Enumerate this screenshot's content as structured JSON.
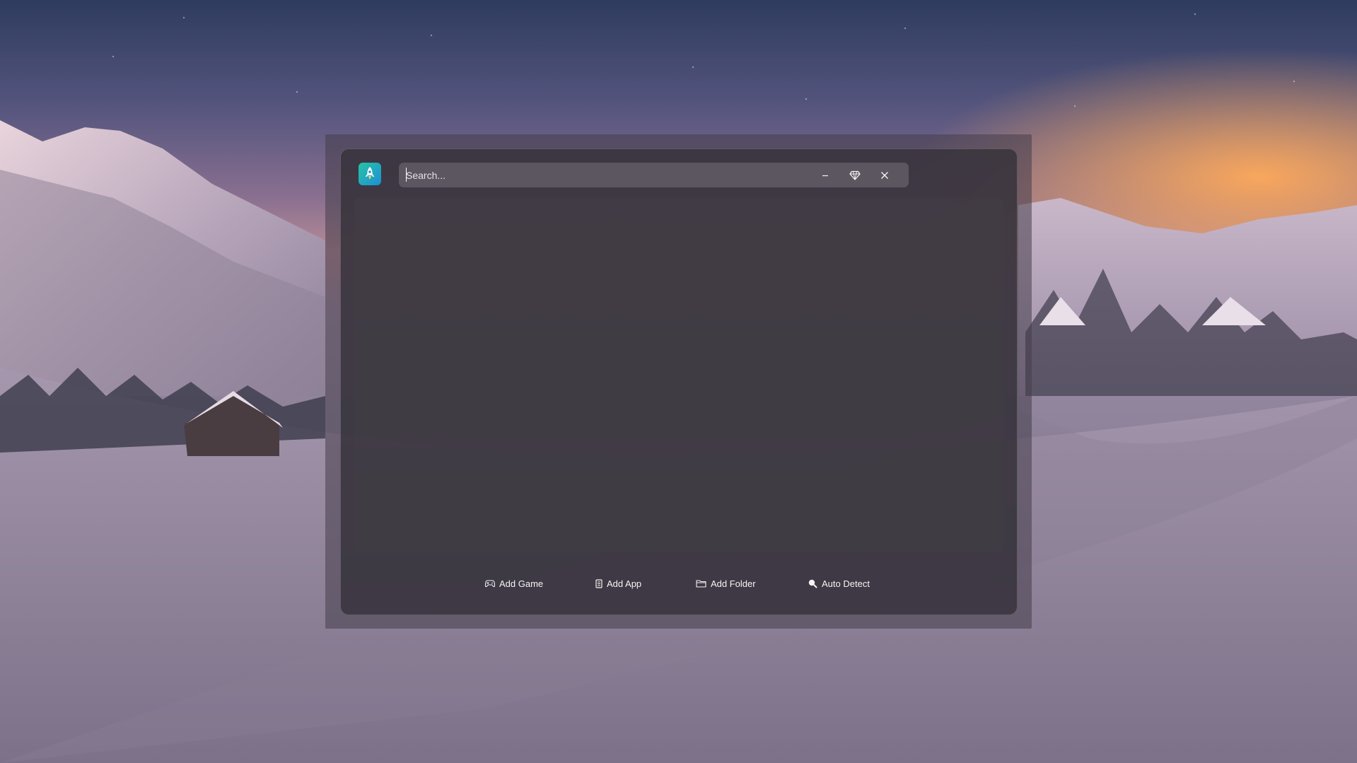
{
  "app": {
    "logo_icon": "rocket-icon",
    "accent_colors": [
      "#27c3a3",
      "#1d8fd6"
    ]
  },
  "search": {
    "placeholder": "Search...",
    "value": ""
  },
  "window_controls": {
    "minimize_icon": "minimize-icon",
    "premium_icon": "diamond-icon",
    "close_icon": "close-icon"
  },
  "footer": {
    "buttons": [
      {
        "label": "Add Game",
        "icon": "gamepad-icon"
      },
      {
        "label": "Add App",
        "icon": "app-icon"
      },
      {
        "label": "Add Folder",
        "icon": "folder-icon"
      },
      {
        "label": "Auto Detect",
        "icon": "magnifier-icon"
      }
    ]
  }
}
